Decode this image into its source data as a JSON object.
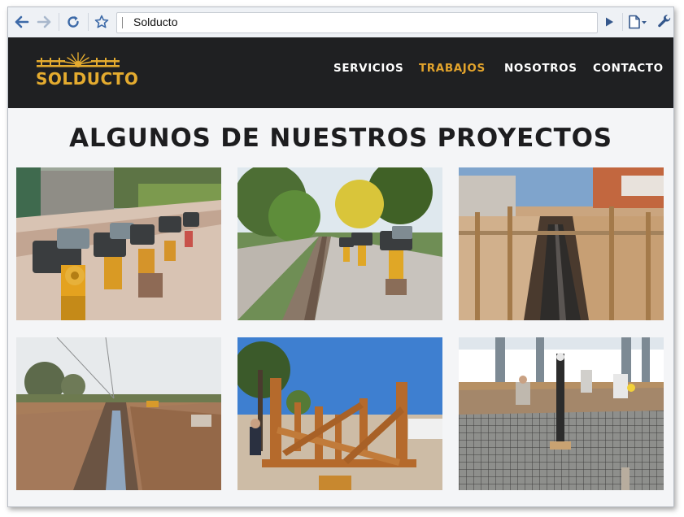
{
  "browser": {
    "url_text": "Solducto",
    "icons": [
      "back-arrow-icon",
      "forward-arrow-icon",
      "reload-icon",
      "star-icon",
      "go-arrow-icon",
      "page-menu-icon",
      "wrench-icon"
    ]
  },
  "site": {
    "logo_text": "SOLDUCTO",
    "nav": [
      {
        "label": "SERVICIOS",
        "active": false
      },
      {
        "label": "TRABAJOS",
        "active": true
      },
      {
        "label": "NOSOTROS",
        "active": false
      },
      {
        "label": "CONTACTO",
        "active": false
      }
    ],
    "heading": "ALGUNOS DE NUESTROS PROYECTOS"
  },
  "colors": {
    "nav_bg": "#1f2022",
    "accent": "#e3a42c",
    "heading": "#1d1d1f",
    "page_bg": "#f4f5f7"
  }
}
